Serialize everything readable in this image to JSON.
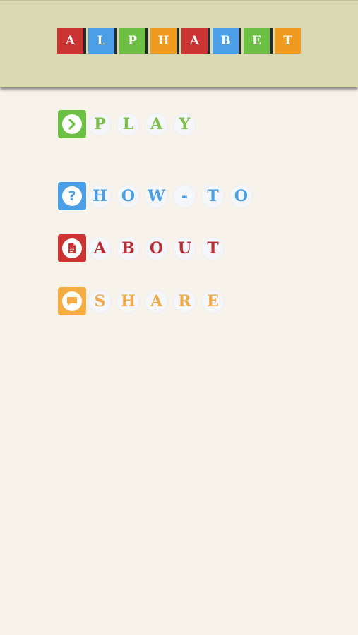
{
  "colors": {
    "red": "#cc3333",
    "blue": "#4a9fe6",
    "green": "#6cc043",
    "orange": "#f09a1f",
    "play_text": "#7cc04a",
    "howto_text": "#4a9fe6",
    "about_text": "#b62d32",
    "share_text": "#f0ab48",
    "header_bg": "#d9d9b4",
    "page_bg": "#f8f3ea"
  },
  "logo": {
    "letters": [
      "A",
      "L",
      "P",
      "H",
      "A",
      "B",
      "E",
      "T"
    ],
    "tile_colors": [
      "#cc3333",
      "#4a9fe6",
      "#6cc043",
      "#f09a1f",
      "#cc3333",
      "#4a9fe6",
      "#6cc043",
      "#f09a1f"
    ]
  },
  "menu": {
    "play": {
      "icon": "chevron-right-icon",
      "letters": [
        "P",
        "L",
        "A",
        "Y"
      ]
    },
    "howto": {
      "icon": "question-mark-icon",
      "glyph": "?",
      "letters": [
        "H",
        "O",
        "W",
        "-",
        "T",
        "O"
      ]
    },
    "about": {
      "icon": "document-icon",
      "letters": [
        "A",
        "B",
        "O",
        "U",
        "T"
      ]
    },
    "share": {
      "icon": "chat-bubble-icon",
      "letters": [
        "S",
        "H",
        "A",
        "R",
        "E"
      ]
    }
  }
}
